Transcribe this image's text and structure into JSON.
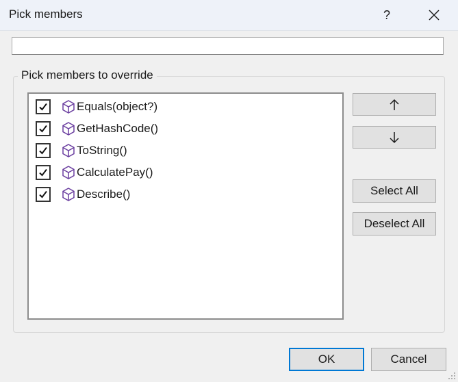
{
  "dialog": {
    "title": "Pick members",
    "help_label": "?"
  },
  "search": {
    "value": "",
    "placeholder": ""
  },
  "group": {
    "label": "Pick members to override"
  },
  "members": [
    {
      "label": "Equals(object?)",
      "checked": true,
      "icon": "member-icon"
    },
    {
      "label": "GetHashCode()",
      "checked": true,
      "icon": "member-icon"
    },
    {
      "label": "ToString()",
      "checked": true,
      "icon": "member-icon"
    },
    {
      "label": "CalculatePay()",
      "checked": true,
      "icon": "member-icon"
    },
    {
      "label": "Describe()",
      "checked": true,
      "icon": "member-icon"
    }
  ],
  "buttons": {
    "move_up_icon": "arrow-up-icon",
    "move_down_icon": "arrow-down-icon",
    "select_all": "Select All",
    "deselect_all": "Deselect All",
    "ok": "OK",
    "cancel": "Cancel"
  },
  "colors": {
    "member_icon": "#6b3fa0",
    "accent": "#0078d4"
  }
}
